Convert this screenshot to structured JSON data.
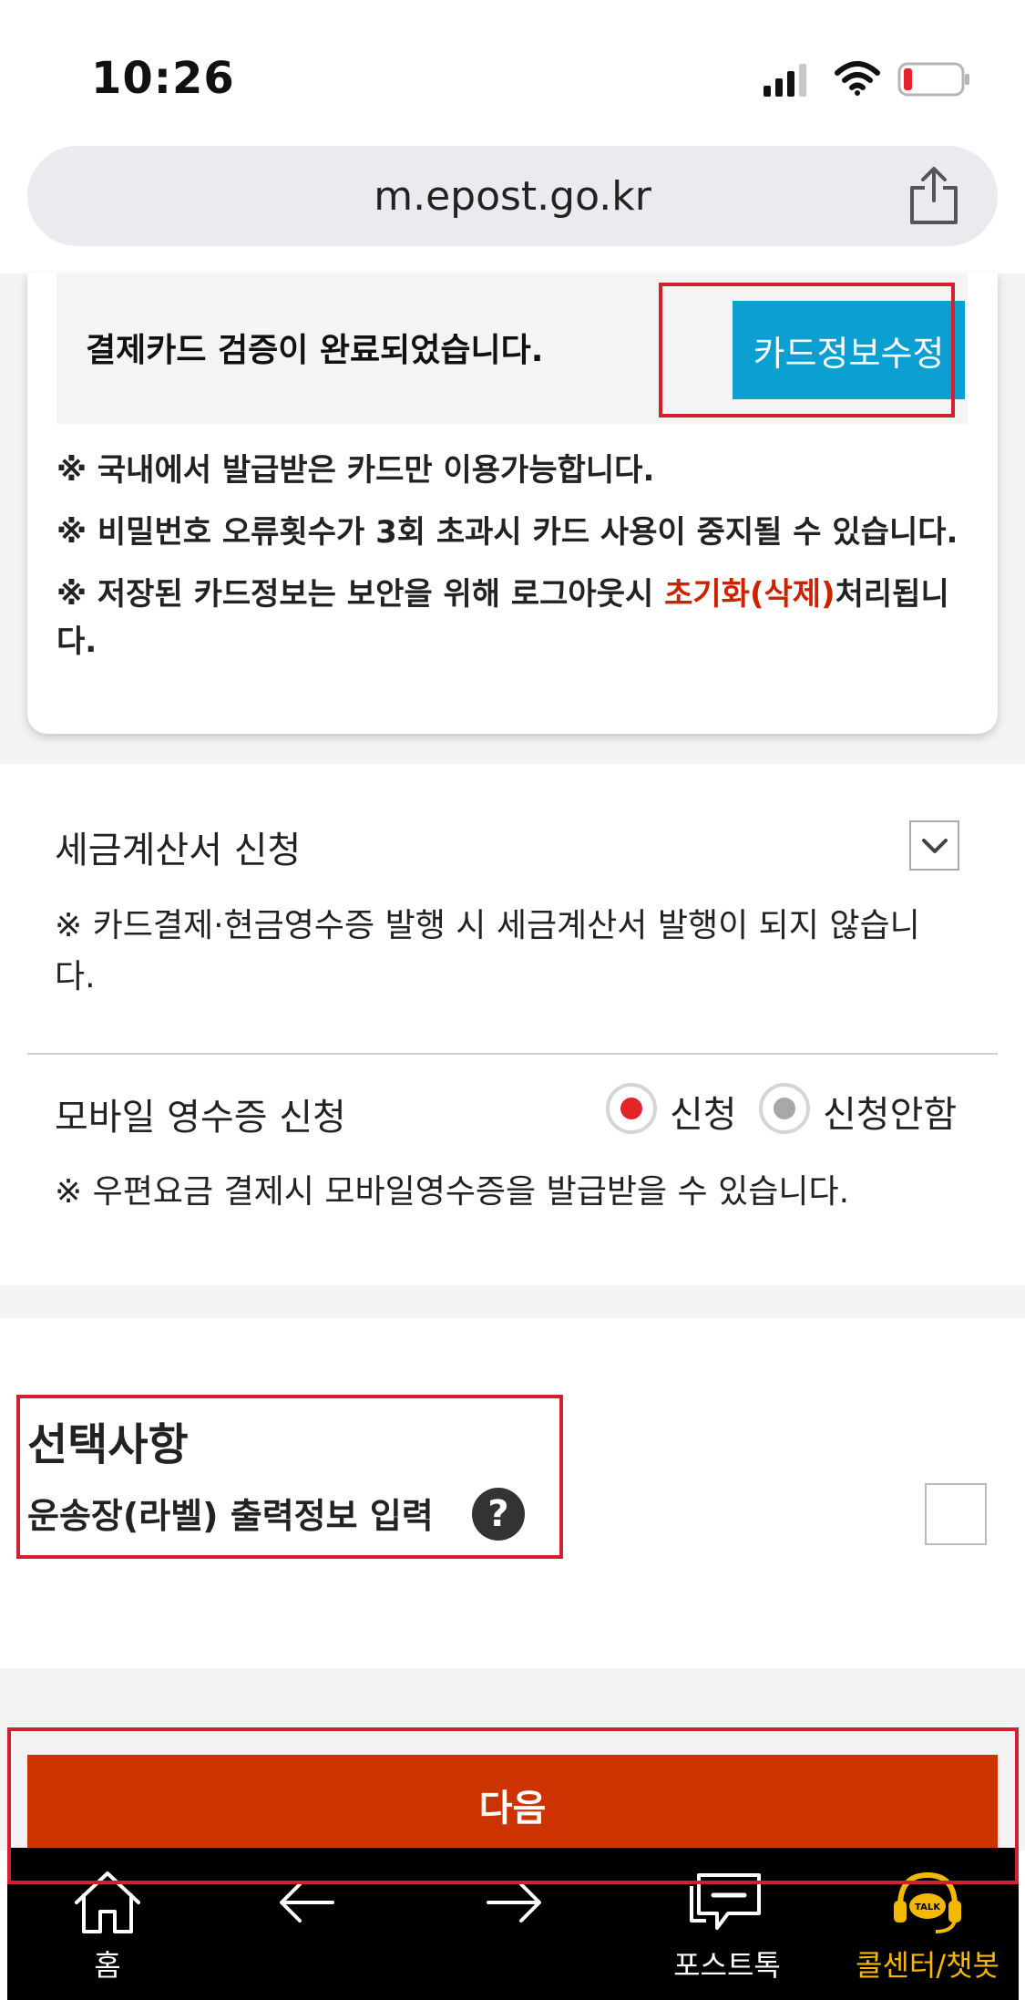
{
  "status_bar": {
    "time": "10:26"
  },
  "browser": {
    "url": "m.epost.go.kr"
  },
  "card_verification": {
    "message": "결제카드 검증이 완료되었습니다.",
    "edit_button_label": "카드정보수정",
    "notes": [
      "※ 국내에서 발급받은 카드만 이용가능합니다.",
      "※ 비밀번호 오류횟수가 3회 초과시 카드 사용이 중지될 수 있습니다."
    ],
    "note3_prefix": "※ 저장된 카드정보는 보안을 위해 로그아웃시 ",
    "note3_emphasis": "초기화(삭제)",
    "note3_suffix": "처리됩니다."
  },
  "tax_invoice": {
    "title": "세금계산서 신청",
    "note": "※ 카드결제·현금영수증 발행 시 세금계산서 발행이 되지 않습니다."
  },
  "mobile_receipt": {
    "title": "모바일 영수증 신청",
    "option_apply": "신청",
    "option_decline": "신청안함",
    "selected": "신청",
    "note": "※ 우편요금 결제시 모바일영수증을 발급받을 수 있습니다."
  },
  "optional": {
    "title": "선택사항",
    "label_info": "운송장(라벨) 출력정보 입력",
    "help_symbol": "?"
  },
  "next_button": {
    "label": "다음"
  },
  "bottom_nav": {
    "home": "홈",
    "posttalk": "포스트톡",
    "callcenter": "콜센터/챗봇",
    "chatbot_badge": "TALK"
  },
  "colors": {
    "accent_blue": "#0c9fd2",
    "next_red": "#cc3300",
    "highlight_red": "#d3202e",
    "emphasis_red": "#cc2200",
    "callcenter_yellow": "#f5b800"
  }
}
